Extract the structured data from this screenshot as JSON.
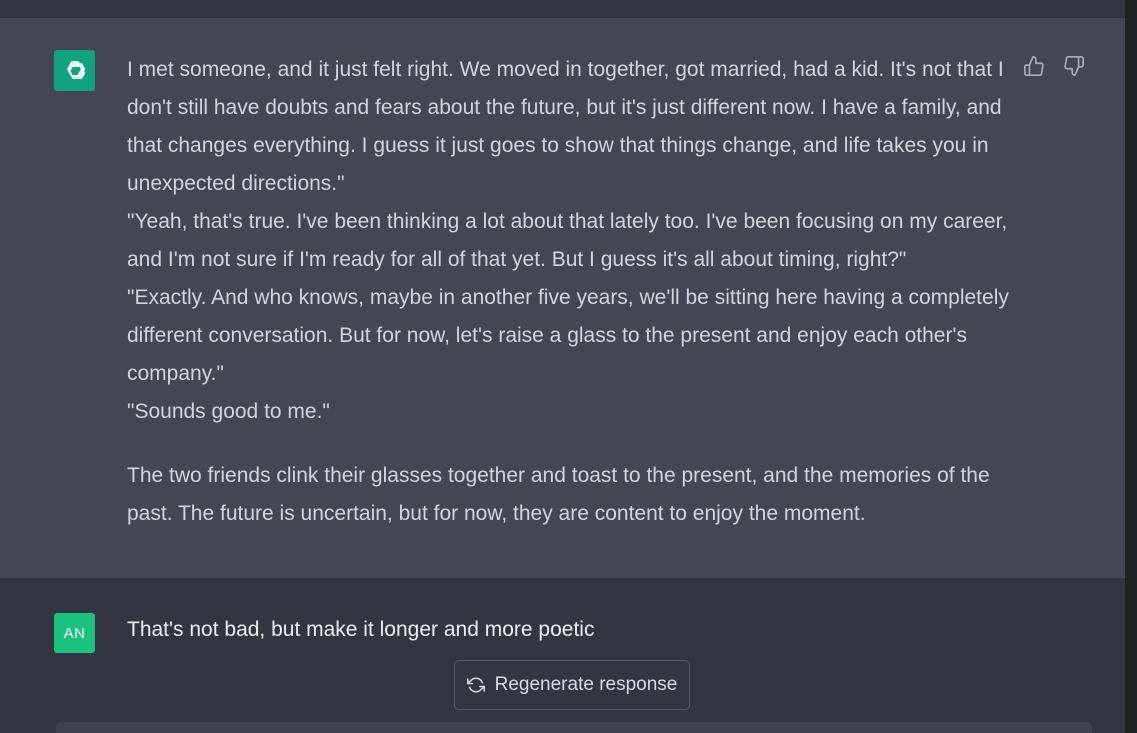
{
  "assistant": {
    "avatar_icon": "openai-logo-icon",
    "paragraphs": [
      "I met someone, and it just felt right. We moved in together, got married, had a kid. It's not that I don't still have doubts and fears about the future, but it's just different now. I have a family, and that changes everything. I guess it just goes to show that things change, and life takes you in unexpected directions.\"",
      "\"Yeah, that's true. I've been thinking a lot about that lately too. I've been focusing on my career, and I'm not sure if I'm ready for all of that yet. But I guess it's all about timing, right?\"",
      "\"Exactly. And who knows, maybe in another five years, we'll be sitting here having a completely different conversation. But for now, let's raise a glass to the present and enjoy each other's company.\"",
      "\"Sounds good to me.\"",
      "The two friends clink their glasses together and toast to the present, and the memories of the past. The future is uncertain, but for now, they are content to enjoy the moment."
    ],
    "feedback": {
      "up_icon": "thumbs-up-icon",
      "down_icon": "thumbs-down-icon"
    }
  },
  "user": {
    "avatar_initials": "AN",
    "message": "That's not bad, but make it longer and more poetic"
  },
  "regenerate": {
    "icon": "refresh-icon",
    "label": "Regenerate response"
  },
  "colors": {
    "assistant_bg": "#444654",
    "user_bg": "#343541",
    "gpt_avatar": "#10a37f",
    "user_avatar": "#19c37d"
  }
}
